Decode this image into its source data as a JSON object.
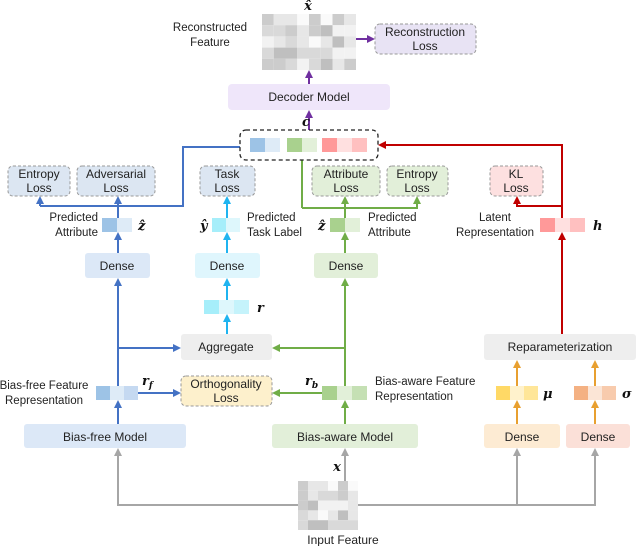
{
  "colors": {
    "blue": "#4472c4",
    "cyan": "#1fb4f0",
    "green": "#70ad47",
    "red": "#c00000",
    "orange": "#e8a030",
    "purple": "#7030a0",
    "grey": "#a6a6a6"
  },
  "top": {
    "xhat": "x̂",
    "reconstructed": [
      "Reconstructed",
      "Feature"
    ],
    "reconstruction_loss": [
      "Reconstruction",
      "Loss"
    ],
    "decoder": "Decoder Model",
    "c": "c"
  },
  "losses": {
    "entropy_left": [
      "Entropy",
      "Loss"
    ],
    "adversarial": [
      "Adversarial",
      "Loss"
    ],
    "task": [
      "Task",
      "Loss"
    ],
    "attribute": [
      "Attribute",
      "Loss"
    ],
    "entropy_right": [
      "Entropy",
      "Loss"
    ],
    "kl": [
      "KL",
      "Loss"
    ]
  },
  "mid": {
    "pred_attr_left": [
      "Predicted",
      "Attribute"
    ],
    "zhat_left": "ẑ",
    "yhat": "ŷ",
    "pred_task": [
      "Predicted",
      "Task Label"
    ],
    "zhat_right": "ẑ",
    "pred_attr_right": [
      "Predicted",
      "Attribute"
    ],
    "latent": [
      "Latent",
      "Representation"
    ],
    "h": "h",
    "dense": "Dense",
    "r": "r",
    "aggregate": "Aggregate",
    "reparam": "Reparameterization"
  },
  "bottom": {
    "bias_free_rep": [
      "Bias-free Feature",
      "Representation"
    ],
    "rf": "r",
    "rf_sub": "f",
    "orthogonality": [
      "Orthogonality",
      "Loss"
    ],
    "rb": "r",
    "rb_sub": "b",
    "bias_aware_rep": [
      "Bias-aware Feature",
      "Representation"
    ],
    "mu": "μ",
    "sigma": "σ",
    "bias_free_model": "Bias-free Model",
    "bias_aware_model": "Bias-aware Model",
    "dense": "Dense",
    "x": "x",
    "input": "Input Feature"
  }
}
